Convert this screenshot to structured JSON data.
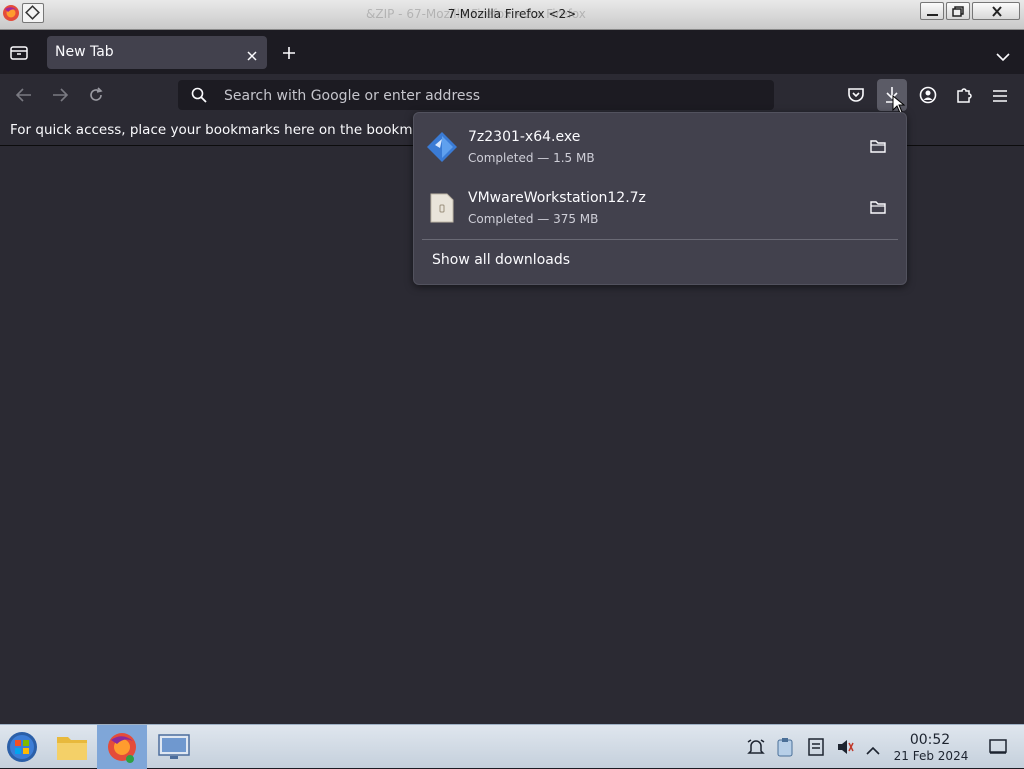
{
  "window": {
    "title": "7-Mozilla Firefox <2>",
    "ghost_title": "&ZIP - 67-Mozilla Firefox <2> Firefox"
  },
  "tabs": [
    {
      "label": "New Tab",
      "active": true
    }
  ],
  "urlbar": {
    "placeholder": "Search with Google or enter address"
  },
  "bookmarks_bar": {
    "message": "For quick access, place your bookmarks here on the bookma"
  },
  "downloads_panel": {
    "items": [
      {
        "filename": "7z2301-x64.exe",
        "status": "Completed — 1.5 MB",
        "icon": "exe-file-icon"
      },
      {
        "filename": "VMwareWorkstation12.7z",
        "status": "Completed — 375 MB",
        "icon": "archive-file-icon"
      }
    ],
    "show_all_label": "Show all downloads"
  },
  "taskbar": {
    "time": "00:52",
    "date": "21 Feb 2024"
  },
  "colors": {
    "accent": "#fbfbfe",
    "toolbar": "#2b2a33",
    "panel": "#42414d",
    "taskbar": "#d5dde6"
  }
}
